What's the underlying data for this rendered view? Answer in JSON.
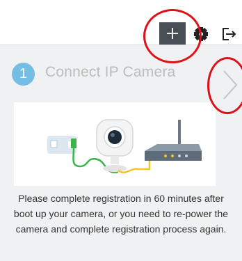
{
  "toolbar": {
    "add_label": "+",
    "icons": [
      "plus-icon",
      "gear-icon",
      "logout-icon"
    ]
  },
  "step": {
    "number": "1",
    "title": "Connect IP Camera"
  },
  "instructions": "Please complete registration in 60 minutes after boot up your camera, or you need to re-power the camera and complete registration process again.",
  "colors": {
    "accent": "#74bde3",
    "toolbar_button": "#4a4f55",
    "panel_bg": "#f0f1f2",
    "annotation": "#e0101a",
    "cable_green": "#3bb54a",
    "cable_yellow": "#f3c623",
    "router": "#5e6b78"
  }
}
